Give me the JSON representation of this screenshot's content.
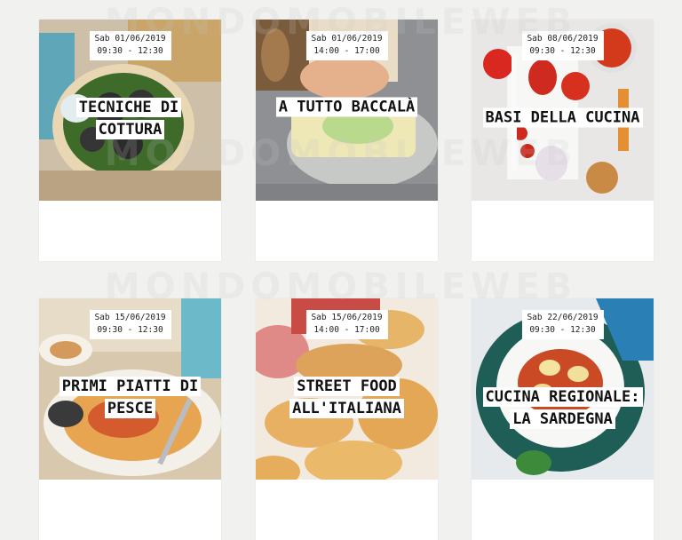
{
  "watermark": "MONDOMOBILEWEB",
  "courses": [
    {
      "date": "Sab 01/06/2019",
      "time": "09:30 - 12:30",
      "title": "TECNICHE DI COTTURA"
    },
    {
      "date": "Sab 01/06/2019",
      "time": "14:00 - 17:00",
      "title": "A TUTTO BACCALÀ"
    },
    {
      "date": "Sab 08/06/2019",
      "time": "09:30 - 12:30",
      "title": "BASI DELLA CUCINA"
    },
    {
      "date": "Sab 15/06/2019",
      "time": "09:30 - 12:30",
      "title": "PRIMI PIATTI DI PESCE"
    },
    {
      "date": "Sab 15/06/2019",
      "time": "14:00 - 17:00",
      "title": "STREET FOOD ALL'ITALIANA"
    },
    {
      "date": "Sab 22/06/2019",
      "time": "09:30 - 12:30",
      "title": "CUCINA REGIONALE: LA SARDEGNA"
    }
  ]
}
